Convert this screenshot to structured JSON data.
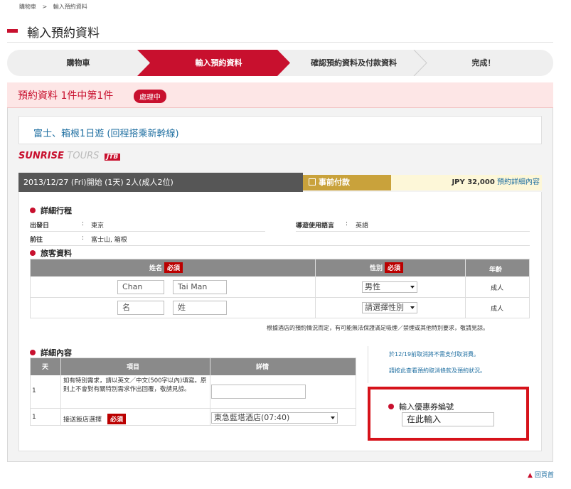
{
  "breadcrumb": {
    "items": [
      "購物車",
      "輸入預約資料"
    ],
    "separator": ">"
  },
  "page": {
    "title": "輸入預約資料"
  },
  "steps": [
    "購物車",
    "輸入預約資料",
    "確認預約資料及付款資料",
    "完成！"
  ],
  "reservation": {
    "title": "預約資料  1件中第1件",
    "status": "處理中",
    "tour_name": "富士、箱根1日遊 (回程搭乘新幹線)"
  },
  "logo": {
    "part1": "SUNRISE",
    "part2": "TOURS",
    "part3": "JTB"
  },
  "summary": {
    "info": "2013/12/27 (Fri)開始   (1天)   2人(成人2位)",
    "payment": "事前付款",
    "price": "JPY 32,000",
    "detail_link": "預約詳細內容"
  },
  "itinerary": {
    "heading": "詳細行程",
    "depart_label": "出發日",
    "depart_value": "東京",
    "dest_label": "前往",
    "dest_value": "富士山, 箱根",
    "guide_label": "導遊使用語言",
    "guide_value": "英語",
    "colon": ":"
  },
  "travelers": {
    "heading": "旅客資料",
    "col_name": "姓名",
    "col_gender": "性別",
    "col_age": "年齡",
    "required": "必須",
    "rows": [
      {
        "first": "Chan",
        "last": "Tai Man",
        "gender": "男性",
        "age": "成人"
      },
      {
        "first": "名",
        "last": "姓",
        "gender": "請選擇性別",
        "age": "成人"
      }
    ],
    "note": "根據酒店的預約情況而定，有可能無法保證滿足吸煙／禁煙或其他特別要求，敬請見諒。"
  },
  "details": {
    "heading": "詳細內容",
    "col_day": "天",
    "col_item": "項目",
    "col_detail": "詳情",
    "rows": [
      {
        "day": "1",
        "item": "如有特別需求，請以英文／中文(500字以內)填寫。原則上不會對有關特別需求作出回覆，敬請見諒。",
        "value": ""
      },
      {
        "day": "1",
        "item": "接送飯店選擇",
        "required": "必須",
        "value": "東急藍塔酒店(07:40)"
      }
    ]
  },
  "side_notes": [
    "於12/19前取消將不需支付取消費。",
    "請按此查看預約取消條款及預約狀況。"
  ],
  "coupon": {
    "label": "輸入優惠券編號",
    "value": "在此輸入"
  },
  "footer": {
    "back_top": "回頁首"
  }
}
